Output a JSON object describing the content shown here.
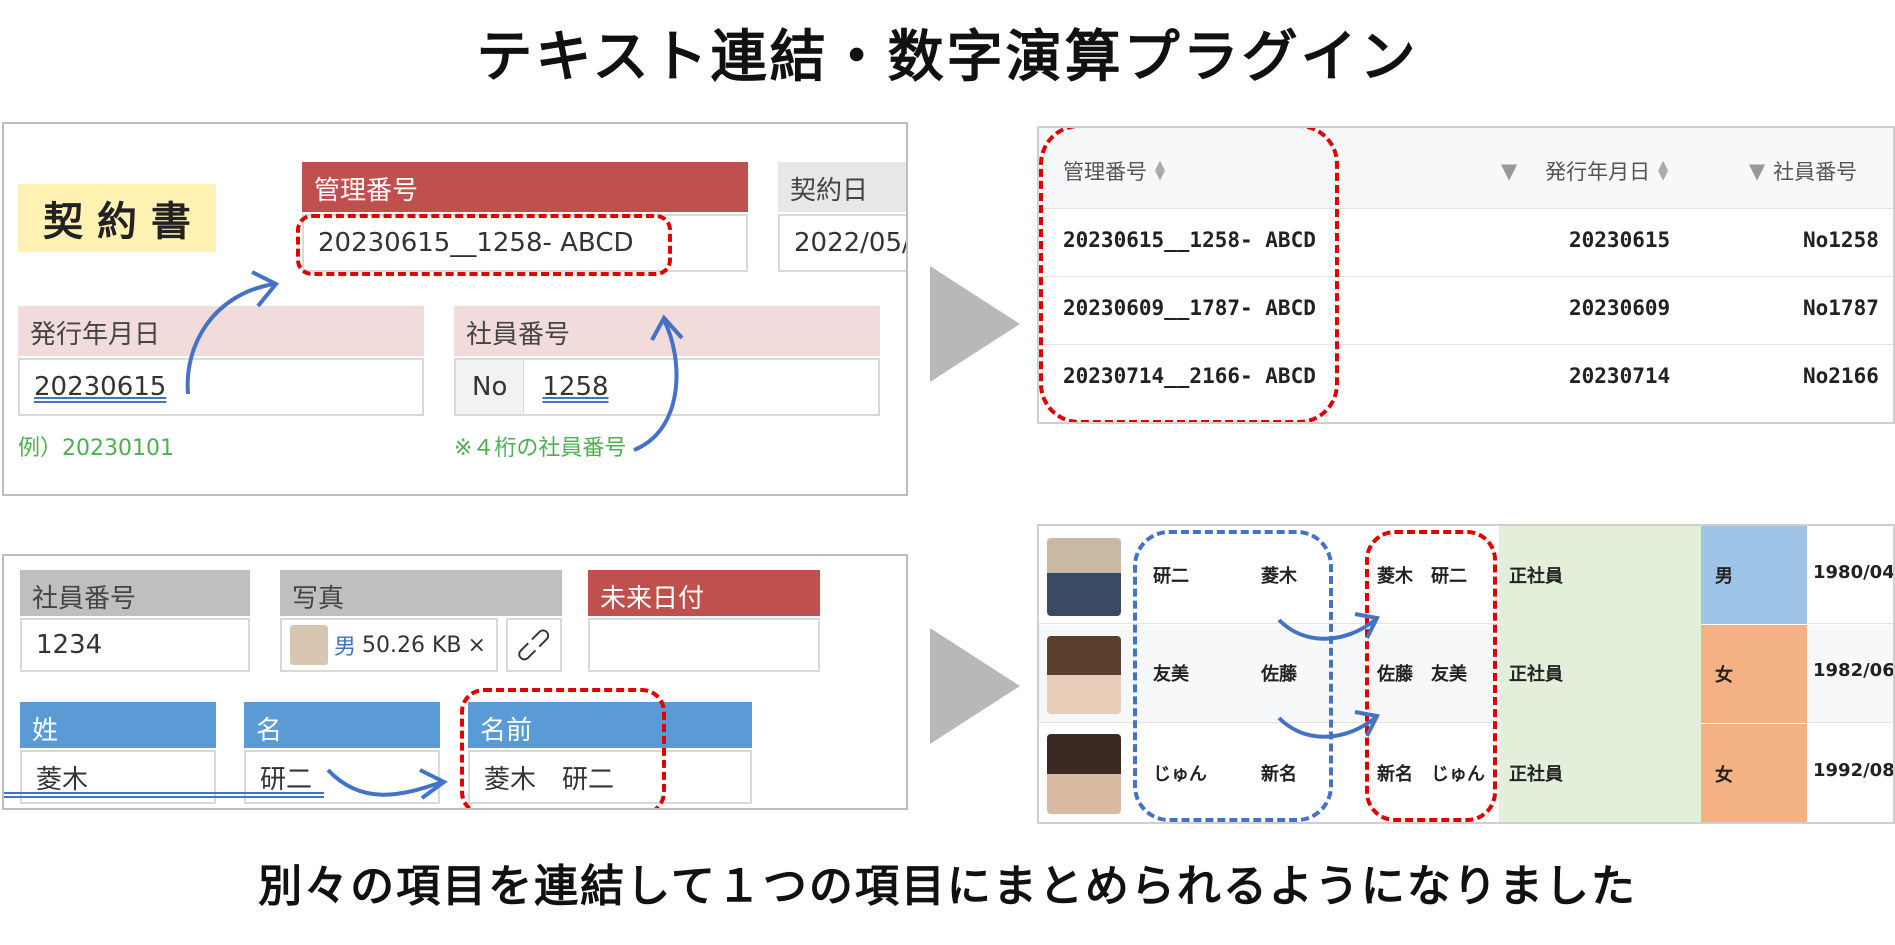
{
  "title": "テキスト連結・数字演算プラグイン",
  "caption": "別々の項目を連結して１つの項目にまとめられるようになりました",
  "form1": {
    "badge": "契 約 書",
    "mgmt_label": "管理番号",
    "mgmt_value": "20230615__1258- ABCD",
    "contract_label": "契約日",
    "contract_value": "2022/05/",
    "issue_label": "発行年月日",
    "issue_value": "20230615",
    "issue_hint": "例）20230101",
    "emp_label": "社員番号",
    "emp_prefix": "No",
    "emp_value": "1258",
    "emp_hint": "※４桁の社員番号"
  },
  "table1": {
    "headers": [
      "管理番号",
      "発行年月日",
      "社員番号"
    ],
    "rows": [
      [
        "20230615__1258- ABCD",
        "20230615",
        "No1258"
      ],
      [
        "20230609__1787- ABCD",
        "20230609",
        "No1787"
      ],
      [
        "20230714__2166- ABCD",
        "20230714",
        "No2166"
      ]
    ]
  },
  "form2": {
    "emp_label": "社員番号",
    "emp_value": "1234",
    "photo_label": "写真",
    "photo_file": "男",
    "photo_size": "50.26 KB",
    "photo_remove": "×",
    "future_label": "未来日付",
    "last_label": "姓",
    "last_value": "菱木",
    "first_label": "名",
    "first_value": "研二",
    "full_label": "名前",
    "full_value": "菱木　研二"
  },
  "table2": {
    "rows": [
      {
        "first": "研二",
        "last": "菱木",
        "full": "菱木　研二",
        "type": "正社員",
        "gender": "男",
        "gender_color": "#9dc3e6",
        "date": "1980/04"
      },
      {
        "first": "友美",
        "last": "佐藤",
        "full": "佐藤　友美",
        "type": "正社員",
        "gender": "女",
        "gender_color": "#f4b183",
        "date": "1982/06"
      },
      {
        "first": "じゅん",
        "last": "新名",
        "full": "新名　じゅん",
        "type": "正社員",
        "gender": "女",
        "gender_color": "#f4b183",
        "date": "1992/08"
      }
    ]
  },
  "colors": {
    "red_dash": "#e00000",
    "blue_dash": "#4472c4",
    "label_red": "#c0504d",
    "label_blue": "#5b9bd5",
    "type_bg": "#e2efda"
  },
  "icons": [
    "arrow-right-icon",
    "filter-icon",
    "sort-icon",
    "paperclip-icon",
    "person-photo-icon"
  ]
}
